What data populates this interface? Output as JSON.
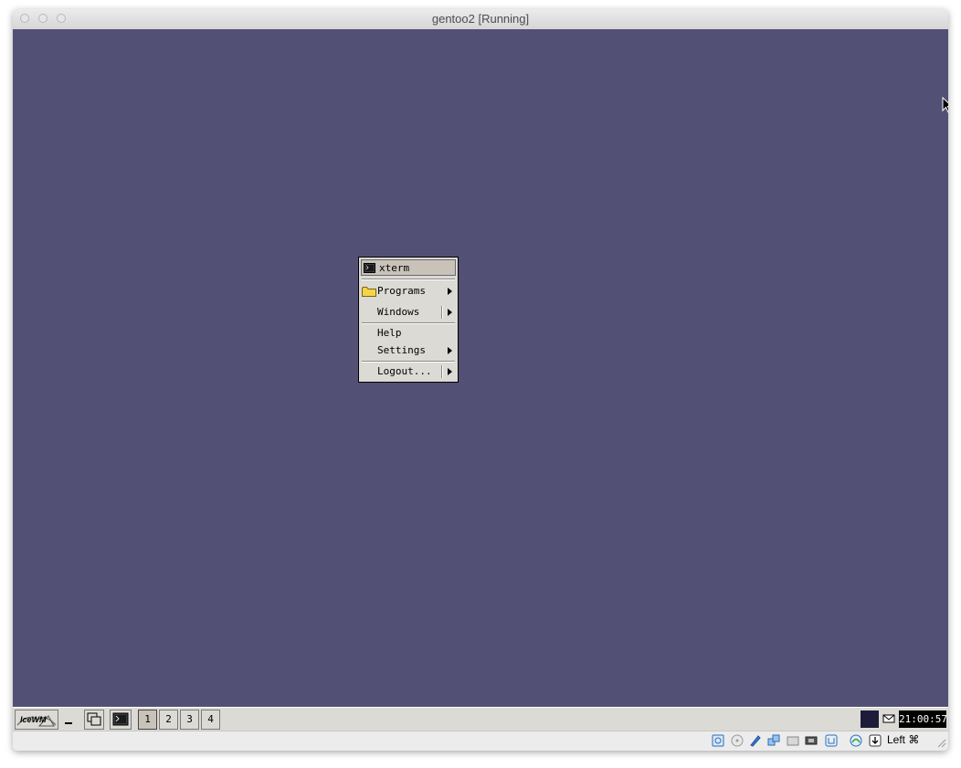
{
  "window": {
    "title": "gentoo2 [Running]"
  },
  "menu": {
    "items": [
      {
        "label": "xterm",
        "icon": "terminal-icon"
      },
      {
        "label": "Programs",
        "icon": "folder-icon"
      },
      {
        "label": "Windows"
      },
      {
        "label": "Help"
      },
      {
        "label": "Settings"
      },
      {
        "label": "Logout..."
      }
    ]
  },
  "taskbar": {
    "start_label": "IceWM",
    "workspaces": [
      "1",
      "2",
      "3",
      "4"
    ],
    "active_workspace": "1",
    "clock": "21:00:57"
  },
  "statusbar": {
    "host_key": "Left ⌘"
  },
  "colors": {
    "desktop": "#525075",
    "menu": "#dcdad5",
    "taskbar": "#dcdad5"
  }
}
